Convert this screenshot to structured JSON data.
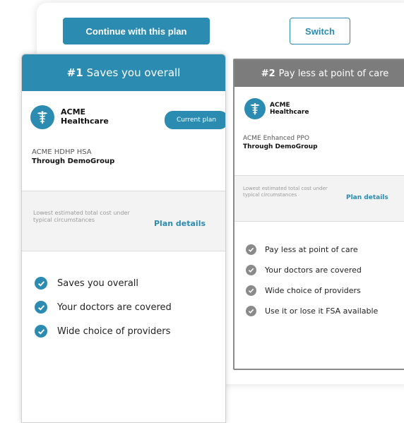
{
  "actions": {
    "continue_label": "Continue with this plan",
    "switch_label": "Switch"
  },
  "colors": {
    "accent": "#2b8bb0",
    "secondary_header": "#7c7c7c",
    "check_gray": "#8a8a8a"
  },
  "plans": [
    {
      "rank": "#1",
      "headline": "Saves you overall",
      "brand_line1": "ACME",
      "brand_line2": "Healthcare",
      "logo_icon": "caduceus-icon",
      "badge": "Current plan",
      "plan_name": "ACME HDHP HSA",
      "through": "Through DemoGroup",
      "estimate_note": "Lowest estimated total cost under typical circumstances",
      "details_label": "Plan details",
      "features": [
        "Saves you overall",
        "Your doctors are covered",
        "Wide choice of providers"
      ]
    },
    {
      "rank": "#2",
      "headline": "Pay less at point of care",
      "brand_line1": "ACME",
      "brand_line2": "Healthcare",
      "logo_icon": "caduceus-icon",
      "plan_name": "ACME Enhanced PPO",
      "through": "Through DemoGroup",
      "estimate_note": "Lowest estimated total cost under typical circumstances",
      "details_label": "Plan details",
      "features": [
        "Pay less at point of care",
        "Your doctors are covered",
        "Wide choice of providers",
        "Use it or lose it FSA available"
      ]
    }
  ]
}
